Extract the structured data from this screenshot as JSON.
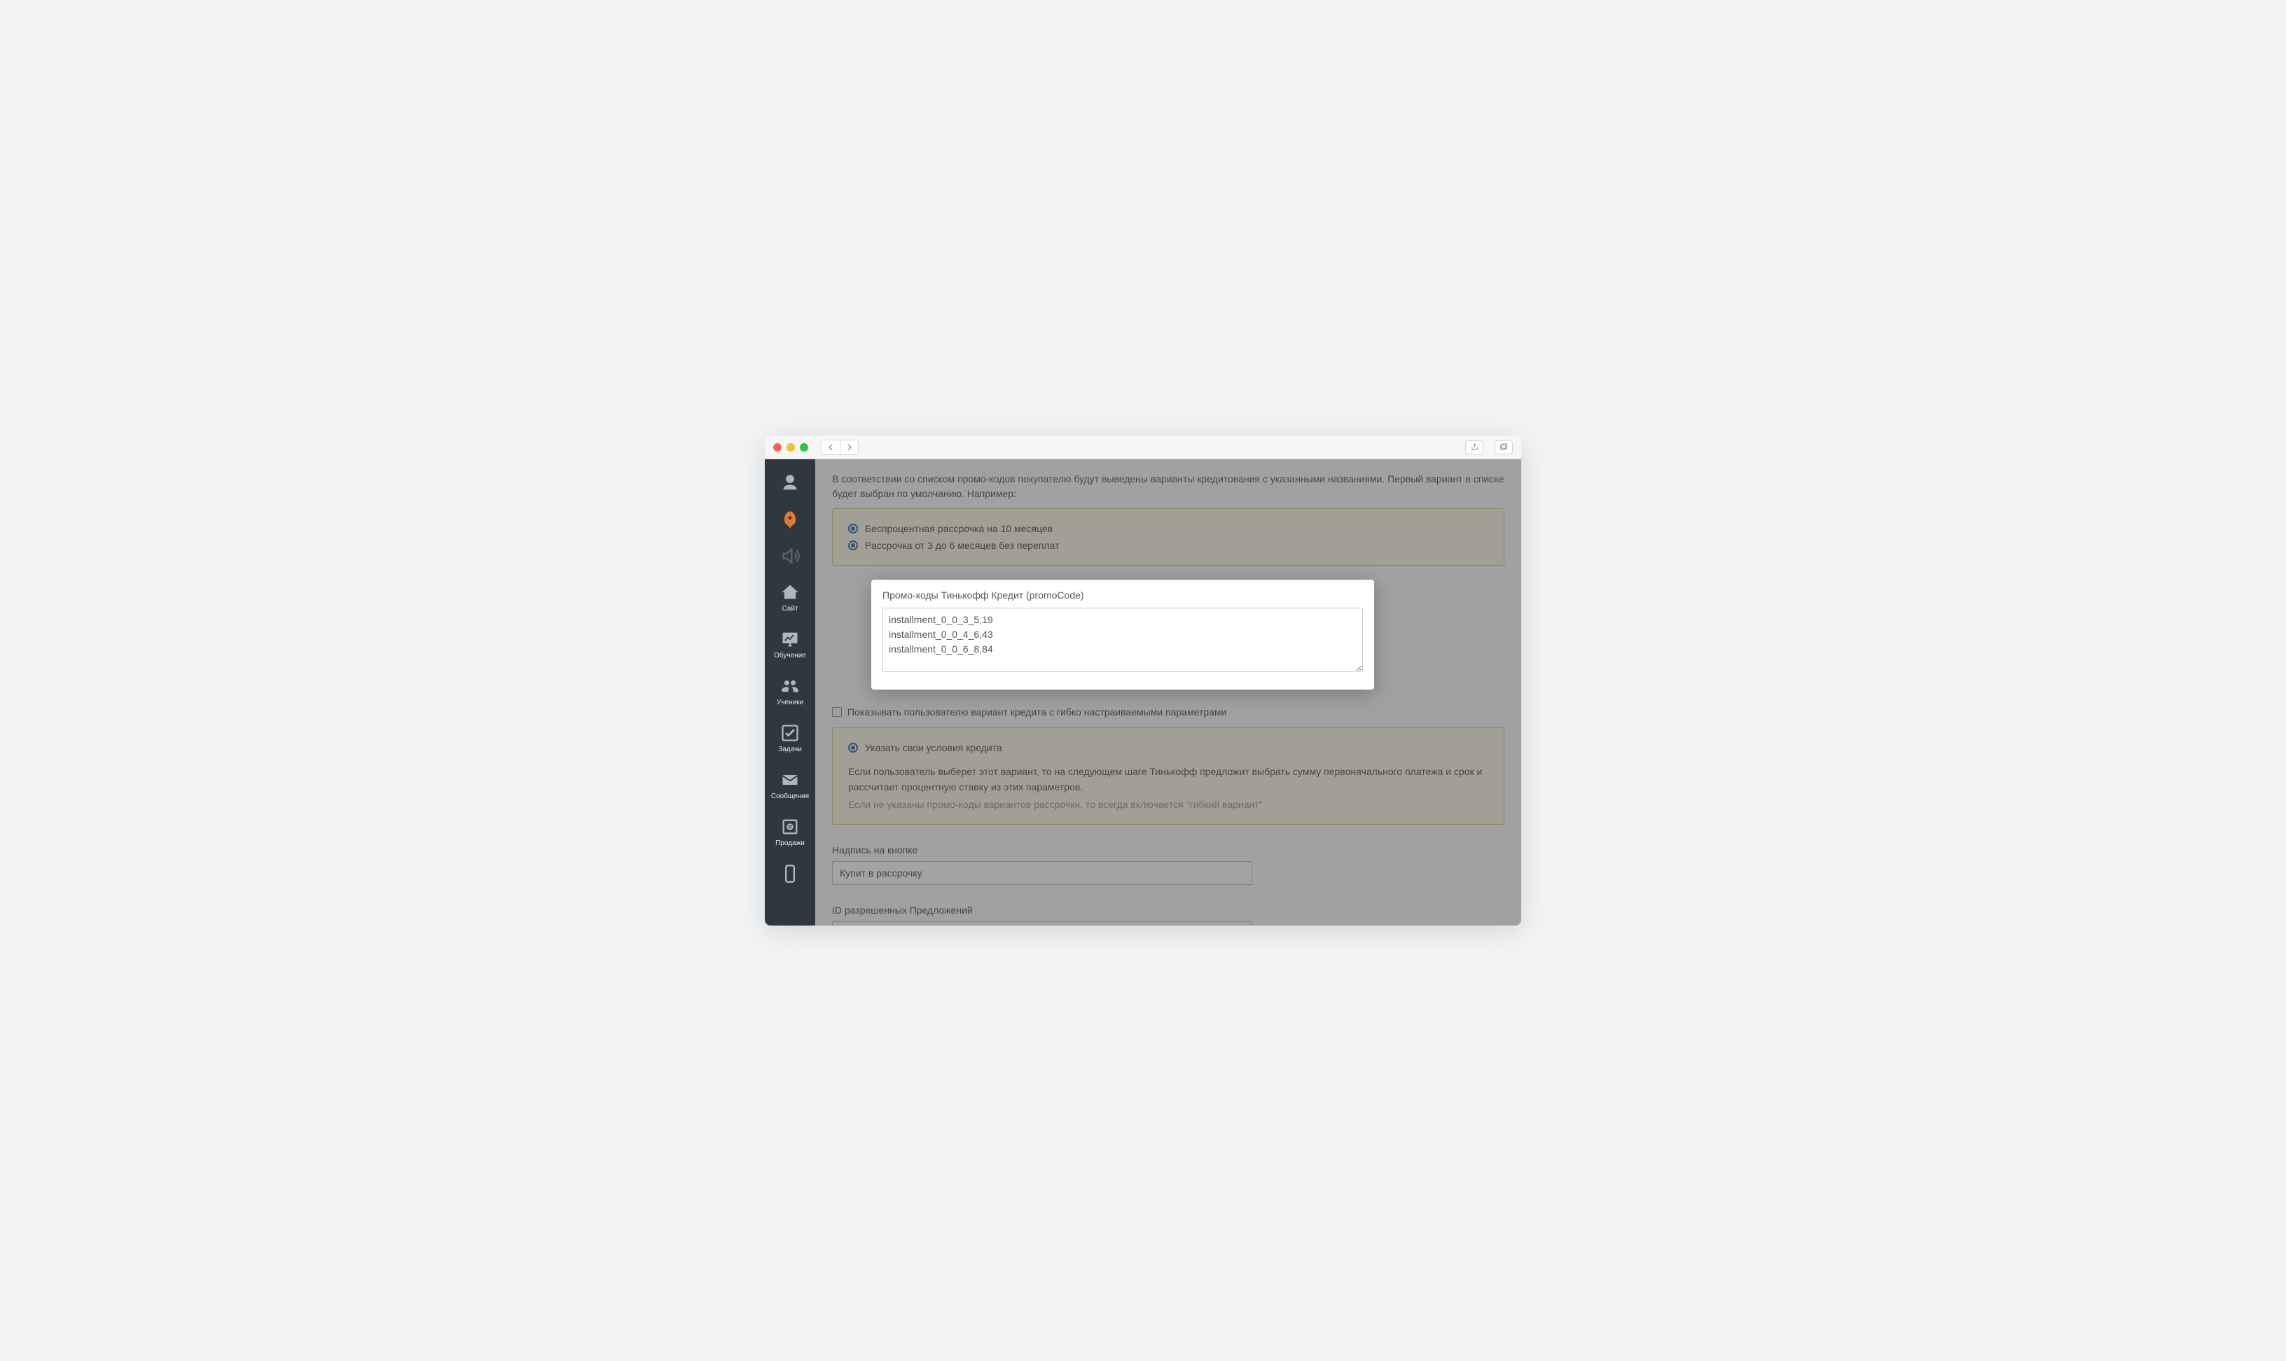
{
  "sidebar": {
    "items": [
      {
        "label": ""
      },
      {
        "label": ""
      },
      {
        "label": ""
      },
      {
        "label": "Сайт"
      },
      {
        "label": "Обучение"
      },
      {
        "label": "Ученики"
      },
      {
        "label": "Задачи"
      },
      {
        "label": "Сообщения"
      },
      {
        "label": "Продажи"
      },
      {
        "label": ""
      }
    ]
  },
  "content": {
    "intro": "В соответствии со списком промо-кодов покупателю будут выведены варианты кредитования с указанными названиями. Первый вариант в списке будет выбран по умолчанию. Например:",
    "option1": "Беспроцентная рассрочка на 10 месяцев",
    "option2": "Рассрочка от 3 до 6 месяцев без переплат",
    "promo_label": "Промо-коды Тинькофф Кредит (promoCode)",
    "promo_value": "installment_0_0_3_5,19\ninstallment_0_0_4_6,43\ninstallment_0_0_6_8,84",
    "checkbox_label": "Показывать пользователю вариант кредита с гибко настраиваемыми параметрами",
    "flex_option": "Указать свои условия кредита",
    "flex_desc": "Если пользователь выберет этот вариант, то на следующем шаге Тинькофф предложит выбрать сумму первоначального платежа и срок и рассчитает процентную ставку из этих параметров.",
    "flex_hint": "Если не указаны промо-коды вариантов рассрочки, то всегда включается \"гибкий вариант\"",
    "btn_label_caption": "Надпись на кнопке",
    "btn_label_value": "Купит в рассрочку",
    "offers_caption": "ID разрешенных Предложений",
    "offers_value": ""
  }
}
